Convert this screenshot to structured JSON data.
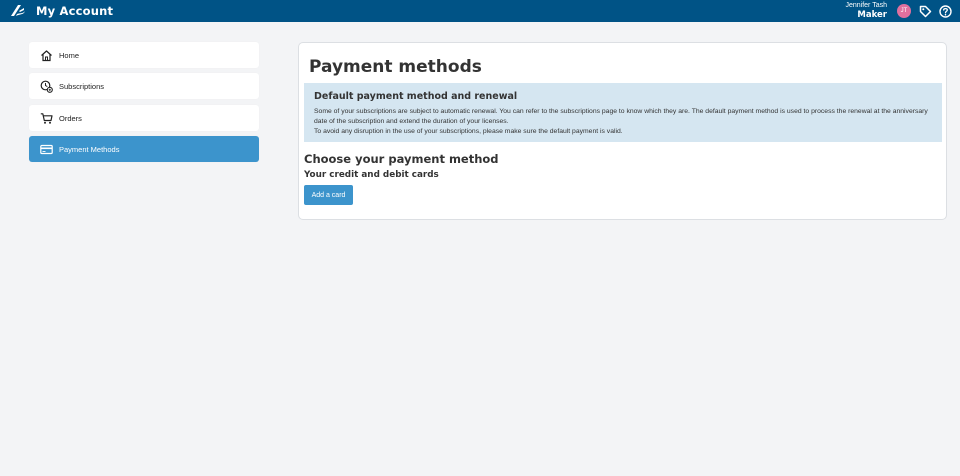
{
  "header": {
    "app_title": "My Account",
    "user_name": "Jennifer Tash",
    "user_role": "Maker",
    "avatar_initials": "JT",
    "avatar_color": "#e0709e",
    "brand_color": "#005386",
    "icons": [
      "3ds-logo-icon",
      "tag-icon",
      "help-icon"
    ]
  },
  "sidebar": {
    "items": [
      {
        "label": "Home",
        "icon": "home-icon"
      },
      {
        "label": "Subscriptions",
        "icon": "subscriptions-icon"
      },
      {
        "label": "Orders",
        "icon": "cart-icon"
      },
      {
        "label": "Payment Methods",
        "icon": "credit-card-icon",
        "active": true
      }
    ],
    "active_color": "#3c94cc"
  },
  "main": {
    "title": "Payment methods",
    "info": {
      "title": "Default payment method and renewal",
      "line1": "Some of your subscriptions are subject to automatic renewal. You can refer to the subscriptions page to know which they are. The default payment method is used to process the renewal at the anniversary date of the subscription and extend the duration of your licenses.",
      "line2": "To avoid any disruption in the use of your subscriptions, please make sure the default payment is valid."
    },
    "choose_title": "Choose your payment method",
    "cards_title": "Your credit and debit cards",
    "add_card_label": "Add a card"
  }
}
